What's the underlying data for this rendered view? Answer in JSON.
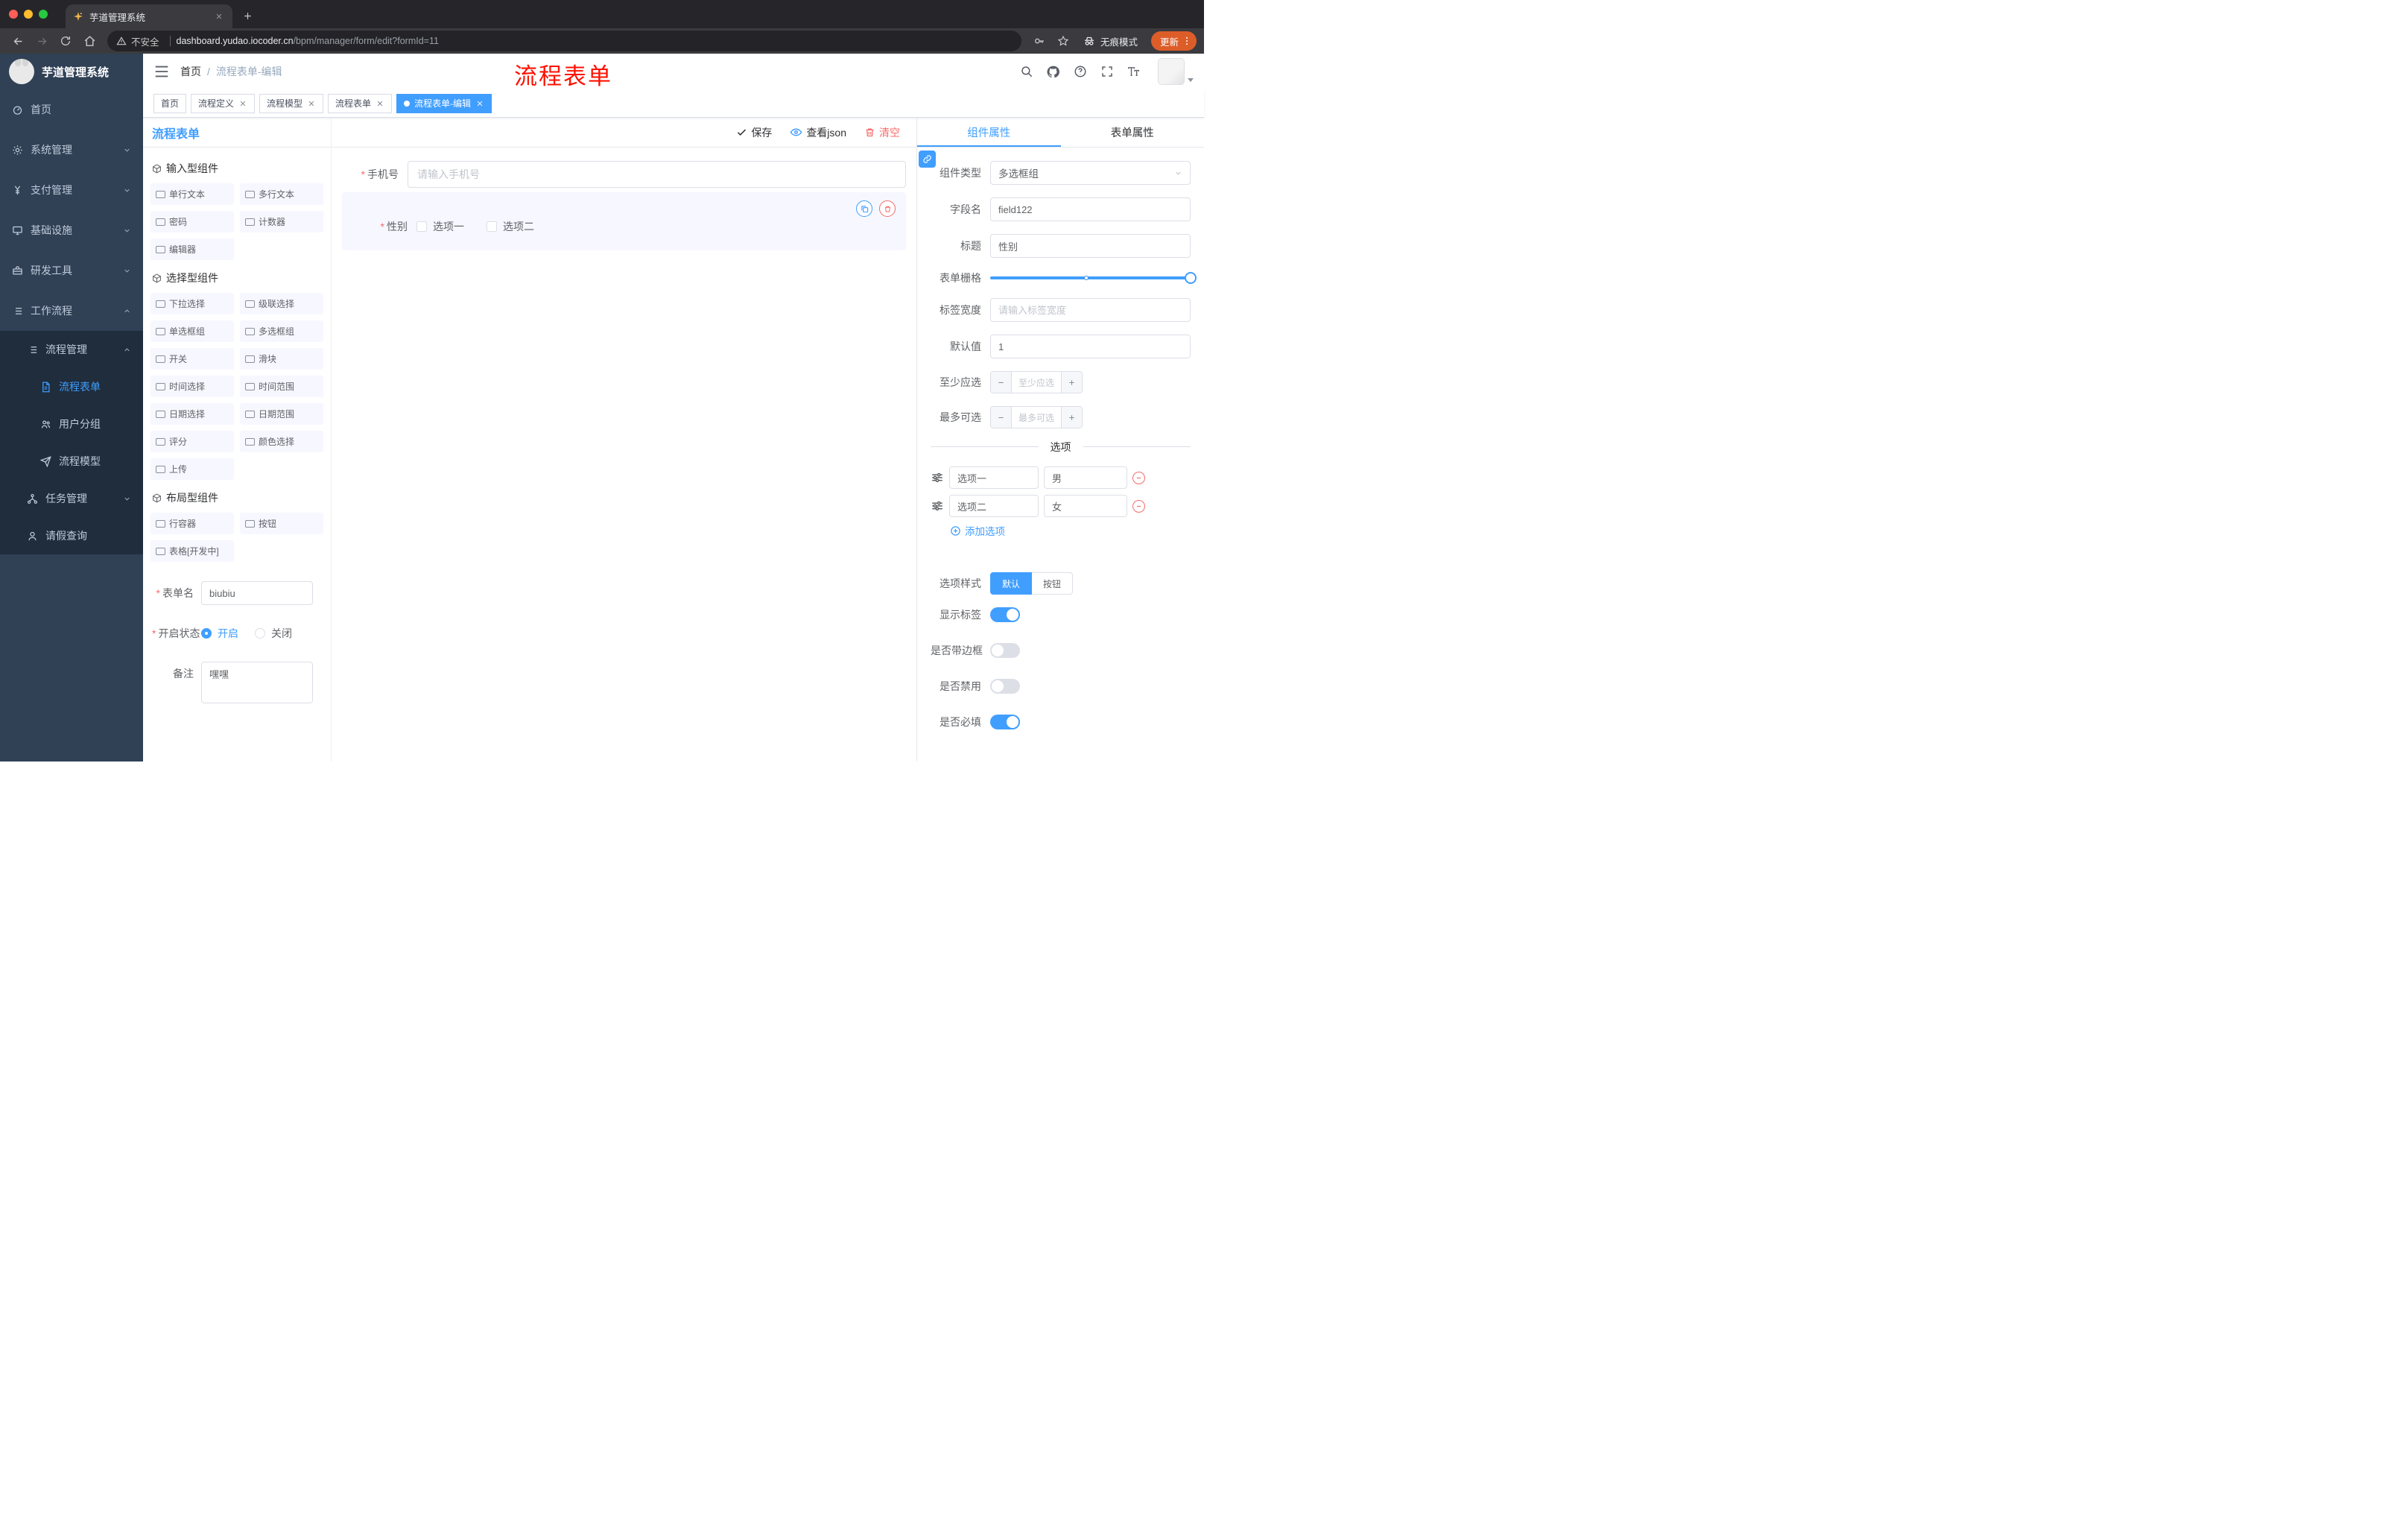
{
  "colors": {
    "primary": "#409eff",
    "danger": "#f56c6c",
    "annotation_red": "#fd1100",
    "sidebar_bg": "#304156",
    "submenu_bg": "#1f2d3d",
    "update_button_bg": "#dd5d29",
    "palette_item_bg": "#f6f7ff"
  },
  "icons": {
    "favicon": "gold sparkle logo",
    "close-icon": "x cross",
    "new-tab-icon": "plus",
    "warning-icon": "triangle exclamation",
    "key-icon": "key",
    "star-icon": "star outline",
    "incognito-icon": "hat and glasses",
    "kebab-icon": "three vertical dots",
    "hamburger-icon": "three horizontal lines",
    "search-icon": "magnifier",
    "github-icon": "octocat",
    "help-icon": "question circle",
    "fullscreen-icon": "expand corners",
    "font-size-icon": "large and small T",
    "check-icon": "checkmark",
    "eye-icon": "eye",
    "trash-icon": "trash can",
    "copy-icon": "overlapping rectangles",
    "link-icon": "chain link",
    "drag-handle-icon": "tune sliders",
    "remove-icon": "minus in red circle",
    "add-icon": "plus in circle",
    "chevron-down-icon": "caret down",
    "chevron-up-icon": "caret up"
  },
  "browser": {
    "tab_title": "芋道管理系统",
    "security_label": "不安全",
    "url_domain": "dashboard.yudao.iocoder.cn",
    "url_path": "/bpm/manager/form/edit?formId=11",
    "incognito_label": "无痕模式",
    "update_label": "更新"
  },
  "sidebar": {
    "logo_title": "芋道管理系统",
    "items": [
      {
        "label": "首页"
      },
      {
        "label": "系统管理"
      },
      {
        "label": "支付管理"
      },
      {
        "label": "基础设施"
      },
      {
        "label": "研发工具"
      },
      {
        "label": "工作流程"
      }
    ],
    "workflow": {
      "process_mgmt": "流程管理",
      "process_children": [
        {
          "label": "流程表单"
        },
        {
          "label": "用户分组"
        },
        {
          "label": "流程模型"
        }
      ],
      "task_mgmt": "任务管理",
      "leave_query": "请假查询"
    }
  },
  "header": {
    "breadcrumb": {
      "home": "首页",
      "sep": "/",
      "current": "流程表单-编辑"
    },
    "annotation": "流程表单"
  },
  "tags": [
    {
      "label": "首页"
    },
    {
      "label": "流程定义"
    },
    {
      "label": "流程模型"
    },
    {
      "label": "流程表单"
    },
    {
      "label": "流程表单-编辑"
    }
  ],
  "designer": {
    "panel_title": "流程表单",
    "actions": {
      "save": "保存",
      "view_json": "查看json",
      "clear": "清空"
    },
    "palette": {
      "groups": [
        {
          "title": "输入型组件",
          "items": [
            "单行文本",
            "多行文本",
            "密码",
            "计数器",
            "编辑器"
          ]
        },
        {
          "title": "选择型组件",
          "items": [
            "下拉选择",
            "级联选择",
            "单选框组",
            "多选框组",
            "开关",
            "滑块",
            "时间选择",
            "时间范围",
            "日期选择",
            "日期范围",
            "评分",
            "颜色选择",
            "上传"
          ]
        },
        {
          "title": "布局型组件",
          "items": [
            "行容器",
            "按钮",
            "表格[开发中]"
          ]
        }
      ]
    },
    "meta": {
      "name_label": "表单名",
      "name_value": "biubiu",
      "status_label": "开启状态",
      "status_on": "开启",
      "status_off": "关闭",
      "remark_label": "备注",
      "remark_value": "嘿嘿"
    },
    "canvas": {
      "phone_label": "手机号",
      "phone_placeholder": "请输入手机号",
      "gender_label": "性别",
      "gender_options": [
        "选项一",
        "选项二"
      ]
    }
  },
  "props": {
    "tabs": {
      "component": "组件属性",
      "form": "表单属性"
    },
    "component_type": {
      "label": "组件类型",
      "value": "多选框组"
    },
    "field_name": {
      "label": "字段名",
      "value": "field122"
    },
    "title": {
      "label": "标题",
      "value": "性别"
    },
    "grid": {
      "label": "表单栅格"
    },
    "label_width": {
      "label": "标签宽度",
      "placeholder": "请输入标签宽度"
    },
    "default": {
      "label": "默认值",
      "value": "1"
    },
    "min_select": {
      "label": "至少应选",
      "placeholder": "至少应选"
    },
    "max_select": {
      "label": "最多可选",
      "placeholder": "最多可选"
    },
    "options_title": "选项",
    "options": [
      {
        "label": "选项一",
        "value": "男"
      },
      {
        "label": "选项二",
        "value": "女"
      }
    ],
    "add_option": "添加选项",
    "option_style": {
      "label": "选项样式",
      "default": "默认",
      "button": "按钮"
    },
    "toggles": [
      {
        "label": "显示标签",
        "on": true
      },
      {
        "label": "是否带边框",
        "on": false
      },
      {
        "label": "是否禁用",
        "on": false
      },
      {
        "label": "是否必填",
        "on": true
      }
    ]
  }
}
